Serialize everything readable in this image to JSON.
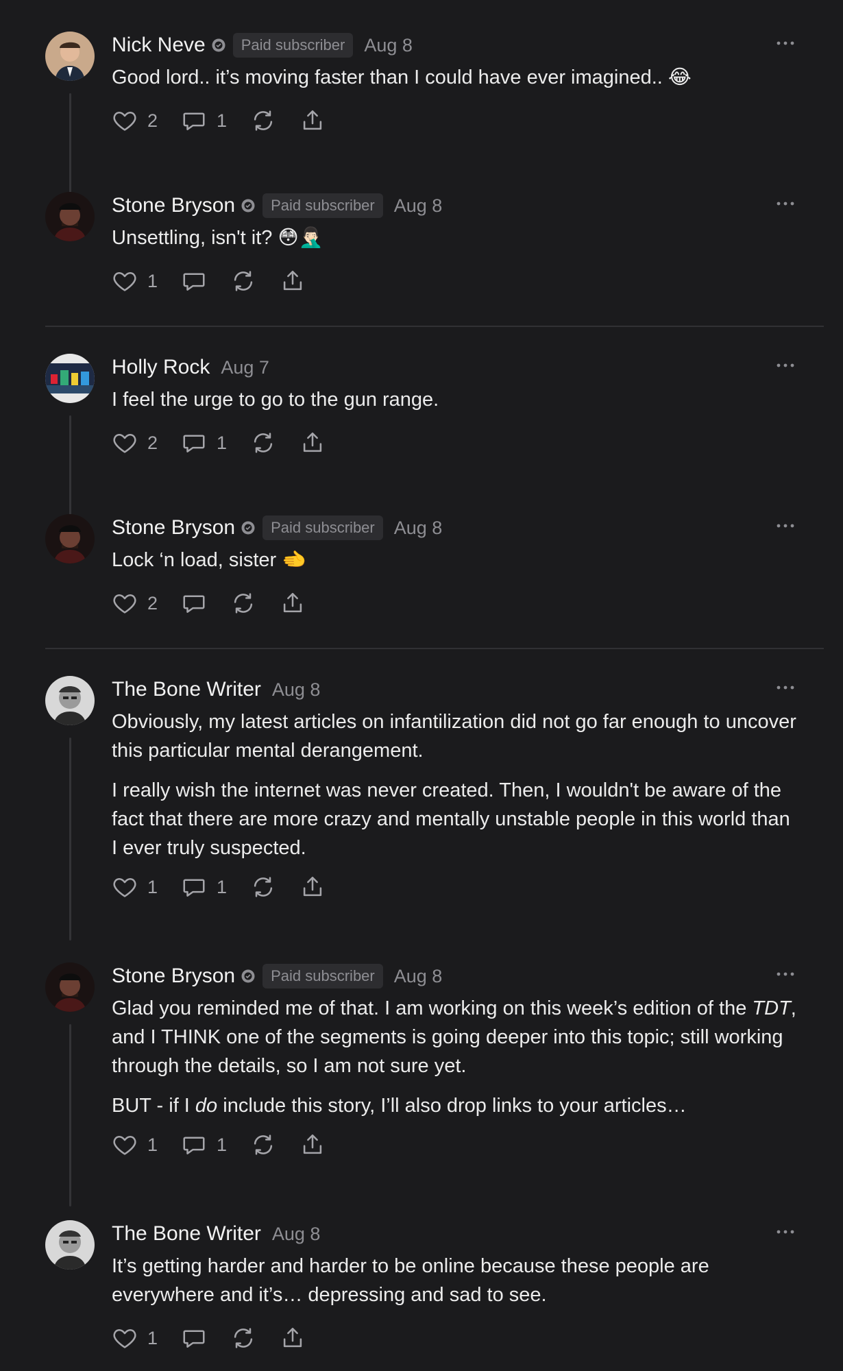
{
  "colors": {
    "background": "#1b1b1d",
    "text": "#ececec",
    "muted": "#8e8e93",
    "pill_bg": "#2d2d30",
    "line": "#333336"
  },
  "icons": {
    "like": "heart-icon",
    "reply": "speech-bubble-icon",
    "restack": "restack-icon",
    "share": "share-icon",
    "more": "ellipsis-icon",
    "badge": "subscriber-badge-icon"
  },
  "comments": [
    {
      "name": "Nick Neve",
      "badge": "Paid subscriber",
      "date": "Aug 8",
      "text": "Good lord.. it’s moving faster than I could have ever imagined.. 😂",
      "likes": "2",
      "replies": "1"
    },
    {
      "name": "Stone Bryson",
      "badge": "Paid subscriber",
      "date": "Aug 8",
      "text": "Unsettling, isn't it? 😳🤦🏻‍♂️",
      "likes": "1",
      "replies": ""
    },
    {
      "name": "Holly Rock",
      "badge": "",
      "date": "Aug 7",
      "text": "I feel the urge to go to the gun range.",
      "likes": "2",
      "replies": "1"
    },
    {
      "name": "Stone Bryson",
      "badge": "Paid subscriber",
      "date": "Aug 8",
      "text": "Lock ‘n load, sister 🫲",
      "likes": "2",
      "replies": ""
    },
    {
      "name": "The Bone Writer",
      "badge": "",
      "date": "Aug 8",
      "p1": "Obviously, my latest articles on infantilization did not go far enough to uncover this particular mental derangement.",
      "p2": "I really wish the internet was never created. Then, I wouldn't be aware of the fact that there are more crazy and mentally unstable people in this world than I ever truly suspected.",
      "likes": "1",
      "replies": "1"
    },
    {
      "name": "Stone Bryson",
      "badge": "Paid subscriber",
      "date": "Aug 8",
      "p1a": "Glad you reminded me of that. I am working on this week’s edition of the ",
      "p1b": "TDT",
      "p1c": ", and I THINK one of the segments is going deeper into this topic; still working through the details, so I am not sure yet.",
      "p2a": "BUT - if I ",
      "p2b": "do",
      "p2c": " include this story, I’ll also drop links to your articles…",
      "likes": "1",
      "replies": "1"
    },
    {
      "name": "The Bone Writer",
      "badge": "",
      "date": "Aug 8",
      "text": "It’s getting harder and harder to be online because these people are everywhere and it’s… depressing and sad to see.",
      "likes": "1",
      "replies": ""
    }
  ]
}
